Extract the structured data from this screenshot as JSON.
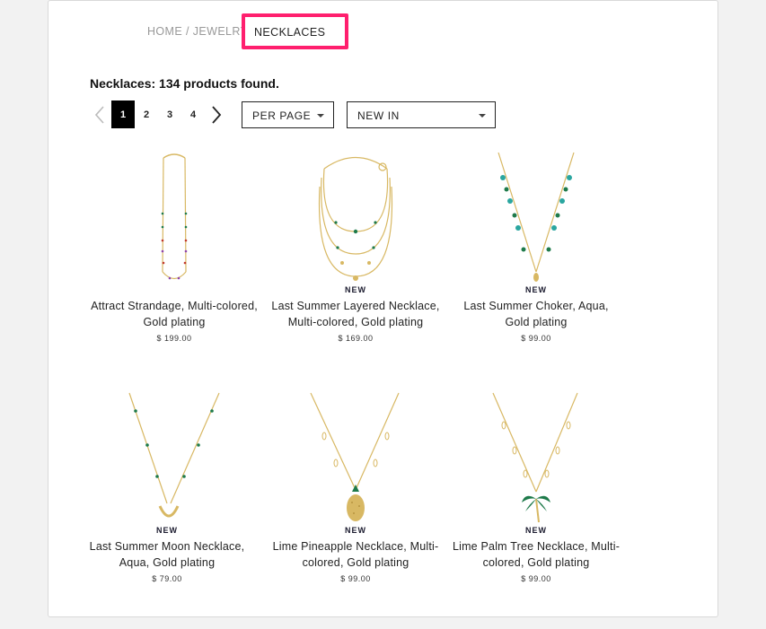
{
  "breadcrumb": {
    "home": "HOME",
    "sep1": " / ",
    "jewelry": "JEWELRY",
    "sep2": " / ",
    "current": "NECKLACES"
  },
  "results_text": "Necklaces: 134 products found.",
  "pagination": {
    "pages": [
      "1",
      "2",
      "3",
      "4"
    ],
    "active": "1"
  },
  "per_page": {
    "label": "PER PAGE"
  },
  "sort": {
    "label": "NEW IN"
  },
  "products": [
    {
      "badge": "",
      "name_line1": "Attract Strandage, Multi-colored,",
      "name_line2": "Gold plating",
      "price": "$ 199.00"
    },
    {
      "badge": "NEW",
      "name_line1": "Last Summer Layered Necklace,",
      "name_line2": "Multi-colored, Gold plating",
      "price": "$ 169.00"
    },
    {
      "badge": "NEW",
      "name_line1": "Last Summer Choker, Aqua,",
      "name_line2": "Gold plating",
      "price": "$ 99.00"
    },
    {
      "badge": "NEW",
      "name_line1": "Last Summer Moon Necklace,",
      "name_line2": "Aqua, Gold plating",
      "price": "$ 79.00"
    },
    {
      "badge": "NEW",
      "name_line1": "Lime Pineapple Necklace, Multi-",
      "name_line2": "colored, Gold plating",
      "price": "$ 99.00"
    },
    {
      "badge": "NEW",
      "name_line1": "Lime Palm Tree Necklace, Multi-",
      "name_line2": "colored, Gold plating",
      "price": "$ 99.00"
    }
  ],
  "colors": {
    "highlight": "#ff1f6e",
    "gold": "#d8b863",
    "green": "#1e7a4a",
    "aqua": "#2aa6a0"
  }
}
